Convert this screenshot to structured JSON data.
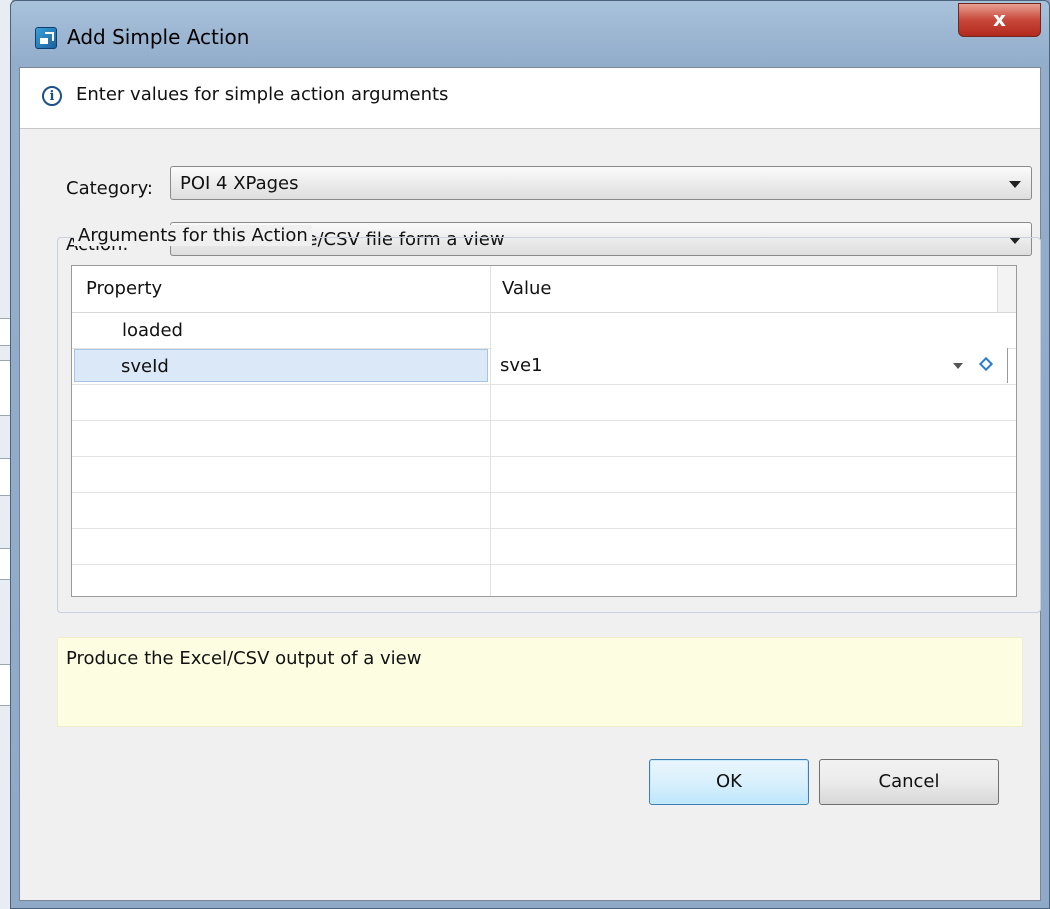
{
  "window": {
    "title": "Add Simple Action",
    "close_label": "x"
  },
  "banner": {
    "message": "Enter values for simple action arguments",
    "icon": "info-icon"
  },
  "form": {
    "category_label": "Category:",
    "category_value": "POI 4 XPages",
    "action_label": "Action:",
    "action_value": "Generate Excle/CSV file form a view"
  },
  "arguments": {
    "group_title": "Arguments for this Action",
    "columns": [
      "Property",
      "Value"
    ],
    "rows": [
      {
        "property": "loaded",
        "value": ""
      },
      {
        "property": "sveId",
        "value": "sve1",
        "selected": true
      }
    ]
  },
  "description": "Produce the Excel/CSV output of a view",
  "buttons": {
    "ok": "OK",
    "cancel": "Cancel"
  }
}
